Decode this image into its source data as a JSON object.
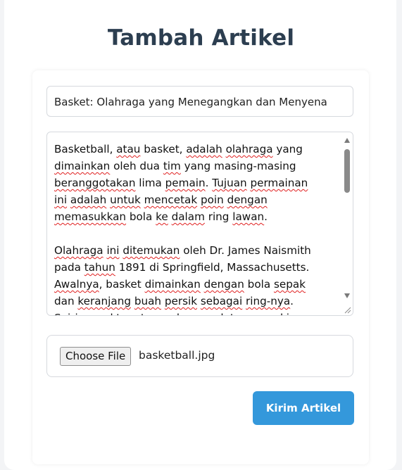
{
  "page": {
    "title": "Tambah Artikel"
  },
  "form": {
    "title_value": "Basket: Olahraga yang Menegangkan dan Menyena",
    "content_lines": [
      [
        {
          "t": "Basketball, "
        },
        {
          "t": "atau",
          "s": 1
        },
        {
          "t": " basket, "
        },
        {
          "t": "adalah",
          "s": 1
        },
        {
          "t": " "
        },
        {
          "t": "olahraga",
          "s": 1
        },
        {
          "t": " yang"
        }
      ],
      [
        {
          "t": "dimainkan",
          "s": 1
        },
        {
          "t": " oleh dua "
        },
        {
          "t": "tim",
          "s": 1
        },
        {
          "t": " yang masing-masing"
        }
      ],
      [
        {
          "t": "beranggotakan",
          "s": 1
        },
        {
          "t": " lima "
        },
        {
          "t": "pemain",
          "s": 1
        },
        {
          "t": ". "
        },
        {
          "t": "Tujuan",
          "s": 1
        },
        {
          "t": " "
        },
        {
          "t": "permainan",
          "s": 1
        }
      ],
      [
        {
          "t": "ini",
          "s": 1
        },
        {
          "t": " "
        },
        {
          "t": "adalah",
          "s": 1
        },
        {
          "t": " "
        },
        {
          "t": "untuk",
          "s": 1
        },
        {
          "t": " "
        },
        {
          "t": "mencetak",
          "s": 1
        },
        {
          "t": " "
        },
        {
          "t": "poin",
          "s": 1
        },
        {
          "t": " "
        },
        {
          "t": "dengan",
          "s": 1
        }
      ],
      [
        {
          "t": "memasukkan",
          "s": 1
        },
        {
          "t": " bola "
        },
        {
          "t": "ke",
          "s": 1
        },
        {
          "t": " "
        },
        {
          "t": "dalam",
          "s": 1
        },
        {
          "t": " ring "
        },
        {
          "t": "lawan",
          "s": 1
        },
        {
          "t": "."
        }
      ],
      [
        {
          "t": ""
        }
      ],
      [
        {
          "t": "Olahraga",
          "s": 1
        },
        {
          "t": " "
        },
        {
          "t": "ini",
          "s": 1
        },
        {
          "t": " "
        },
        {
          "t": "ditemukan",
          "s": 1
        },
        {
          "t": " oleh Dr. James Naismith"
        }
      ],
      [
        {
          "t": "pada "
        },
        {
          "t": "tahun",
          "s": 1
        },
        {
          "t": " 1891 di Springfield, Massachusetts."
        }
      ],
      [
        {
          "t": "Awalnya",
          "s": 1
        },
        {
          "t": ", basket "
        },
        {
          "t": "dimainkan",
          "s": 1
        },
        {
          "t": " "
        },
        {
          "t": "dengan",
          "s": 1
        },
        {
          "t": " bola "
        },
        {
          "t": "sepak",
          "s": 1
        }
      ],
      [
        {
          "t": "dan "
        },
        {
          "t": "keranjang",
          "s": 1
        },
        {
          "t": " "
        },
        {
          "t": "buah",
          "s": 1
        },
        {
          "t": " "
        },
        {
          "t": "persik",
          "s": 1
        },
        {
          "t": " "
        },
        {
          "t": "sebagai",
          "s": 1
        },
        {
          "t": " "
        },
        {
          "t": "ring-nya",
          "s": 1
        },
        {
          "t": "."
        }
      ],
      [
        {
          "t": "Seiring",
          "s": 1
        },
        {
          "t": " "
        },
        {
          "t": "waktu",
          "s": 1
        },
        {
          "t": ", "
        },
        {
          "t": "aturan",
          "s": 1
        },
        {
          "t": " dan "
        },
        {
          "t": "peralatan",
          "s": 1
        },
        {
          "t": " "
        },
        {
          "t": "semakin",
          "s": 1
        }
      ]
    ],
    "file_button_label": "Choose File",
    "file_name": "basketball.jpg",
    "submit_label": "Kirim Artikel"
  },
  "colors": {
    "title": "#2c3e50",
    "submit_bg": "#3498db",
    "background": "#f3f4f6"
  }
}
